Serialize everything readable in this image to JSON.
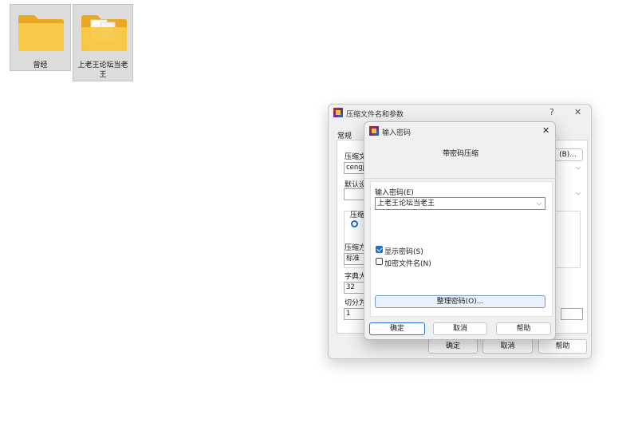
{
  "desktop": {
    "icons": [
      {
        "label": "曾经",
        "icon": "folder-icon"
      },
      {
        "label": "上老王论坛当老王",
        "icon": "folder-with-documents-icon"
      }
    ]
  },
  "archive_dialog": {
    "title": "压缩文件名和参数",
    "help_glyph": "?",
    "close_glyph": "✕",
    "tab_general": "常规",
    "archive_name_label": "压缩文",
    "archive_name_value": "cengjin",
    "browse_button": "(B)...",
    "default_profile_label": "默认设",
    "archive_format_label": "压缩文",
    "method_label": "压缩方",
    "method_value": "标准",
    "dict_label": "字典大",
    "dict_value": "32",
    "split_label": "切分为",
    "split_value": "1",
    "ok_button": "确定",
    "cancel_button": "取消",
    "help_button": "帮助"
  },
  "password_dialog": {
    "title": "输入密码",
    "close_glyph": "✕",
    "header": "带密码压缩",
    "password_label": "输入密码(E)",
    "password_value": "上老王论坛当老王",
    "show_password_label": "显示密码(S)",
    "show_password_checked": true,
    "encrypt_names_label": "加密文件名(N)",
    "encrypt_names_checked": false,
    "organize_button": "整理密码(O)...",
    "ok_button": "确定",
    "cancel_button": "取消",
    "help_button": "帮助"
  },
  "colors": {
    "folder_yellow": "#f7c948",
    "accent_blue": "#2a74c8",
    "winrar_red": "#b3262d"
  }
}
